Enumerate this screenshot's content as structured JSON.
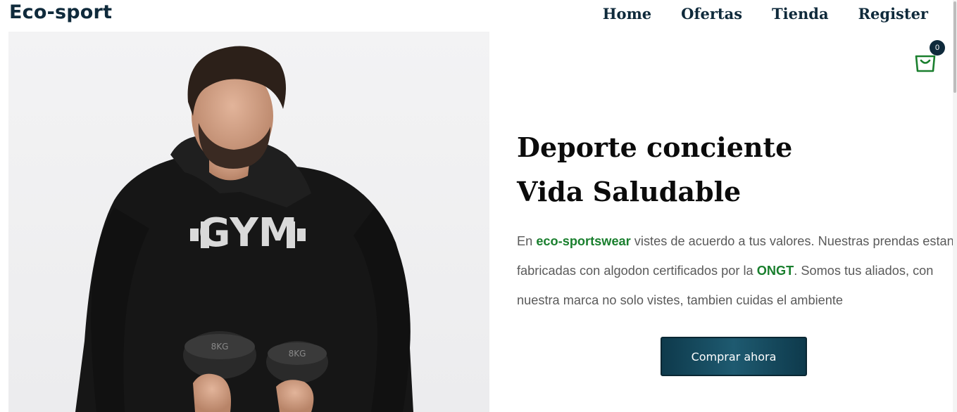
{
  "header": {
    "brand": "Eco-sport",
    "nav": [
      "Home",
      "Ofertas",
      "Tienda",
      "Register"
    ]
  },
  "cart": {
    "count": "0",
    "icon": "shopping-bag-icon"
  },
  "hero": {
    "title_line1": "Deporte conciente",
    "title_line2": "Vida Saludable",
    "desc_part1": "En ",
    "desc_brand": "eco-sportswear",
    "desc_part2": " vistes de acuerdo a tus valores. Nuestras prendas estan fabricadas con algodon certificados por la ",
    "desc_org": "ONGT",
    "desc_part3": ". Somos tus aliados, con nuestra marca no solo vistes, tambien cuidas el ambiente",
    "cta": "Comprar ahora",
    "shirt_text": "GYM",
    "dumbbell_left": "8KG",
    "dumbbell_right": "8KG"
  },
  "colors": {
    "brand_dark": "#0f2a3b",
    "accent_green": "#1a7f2e",
    "button": "#1e5a70"
  }
}
